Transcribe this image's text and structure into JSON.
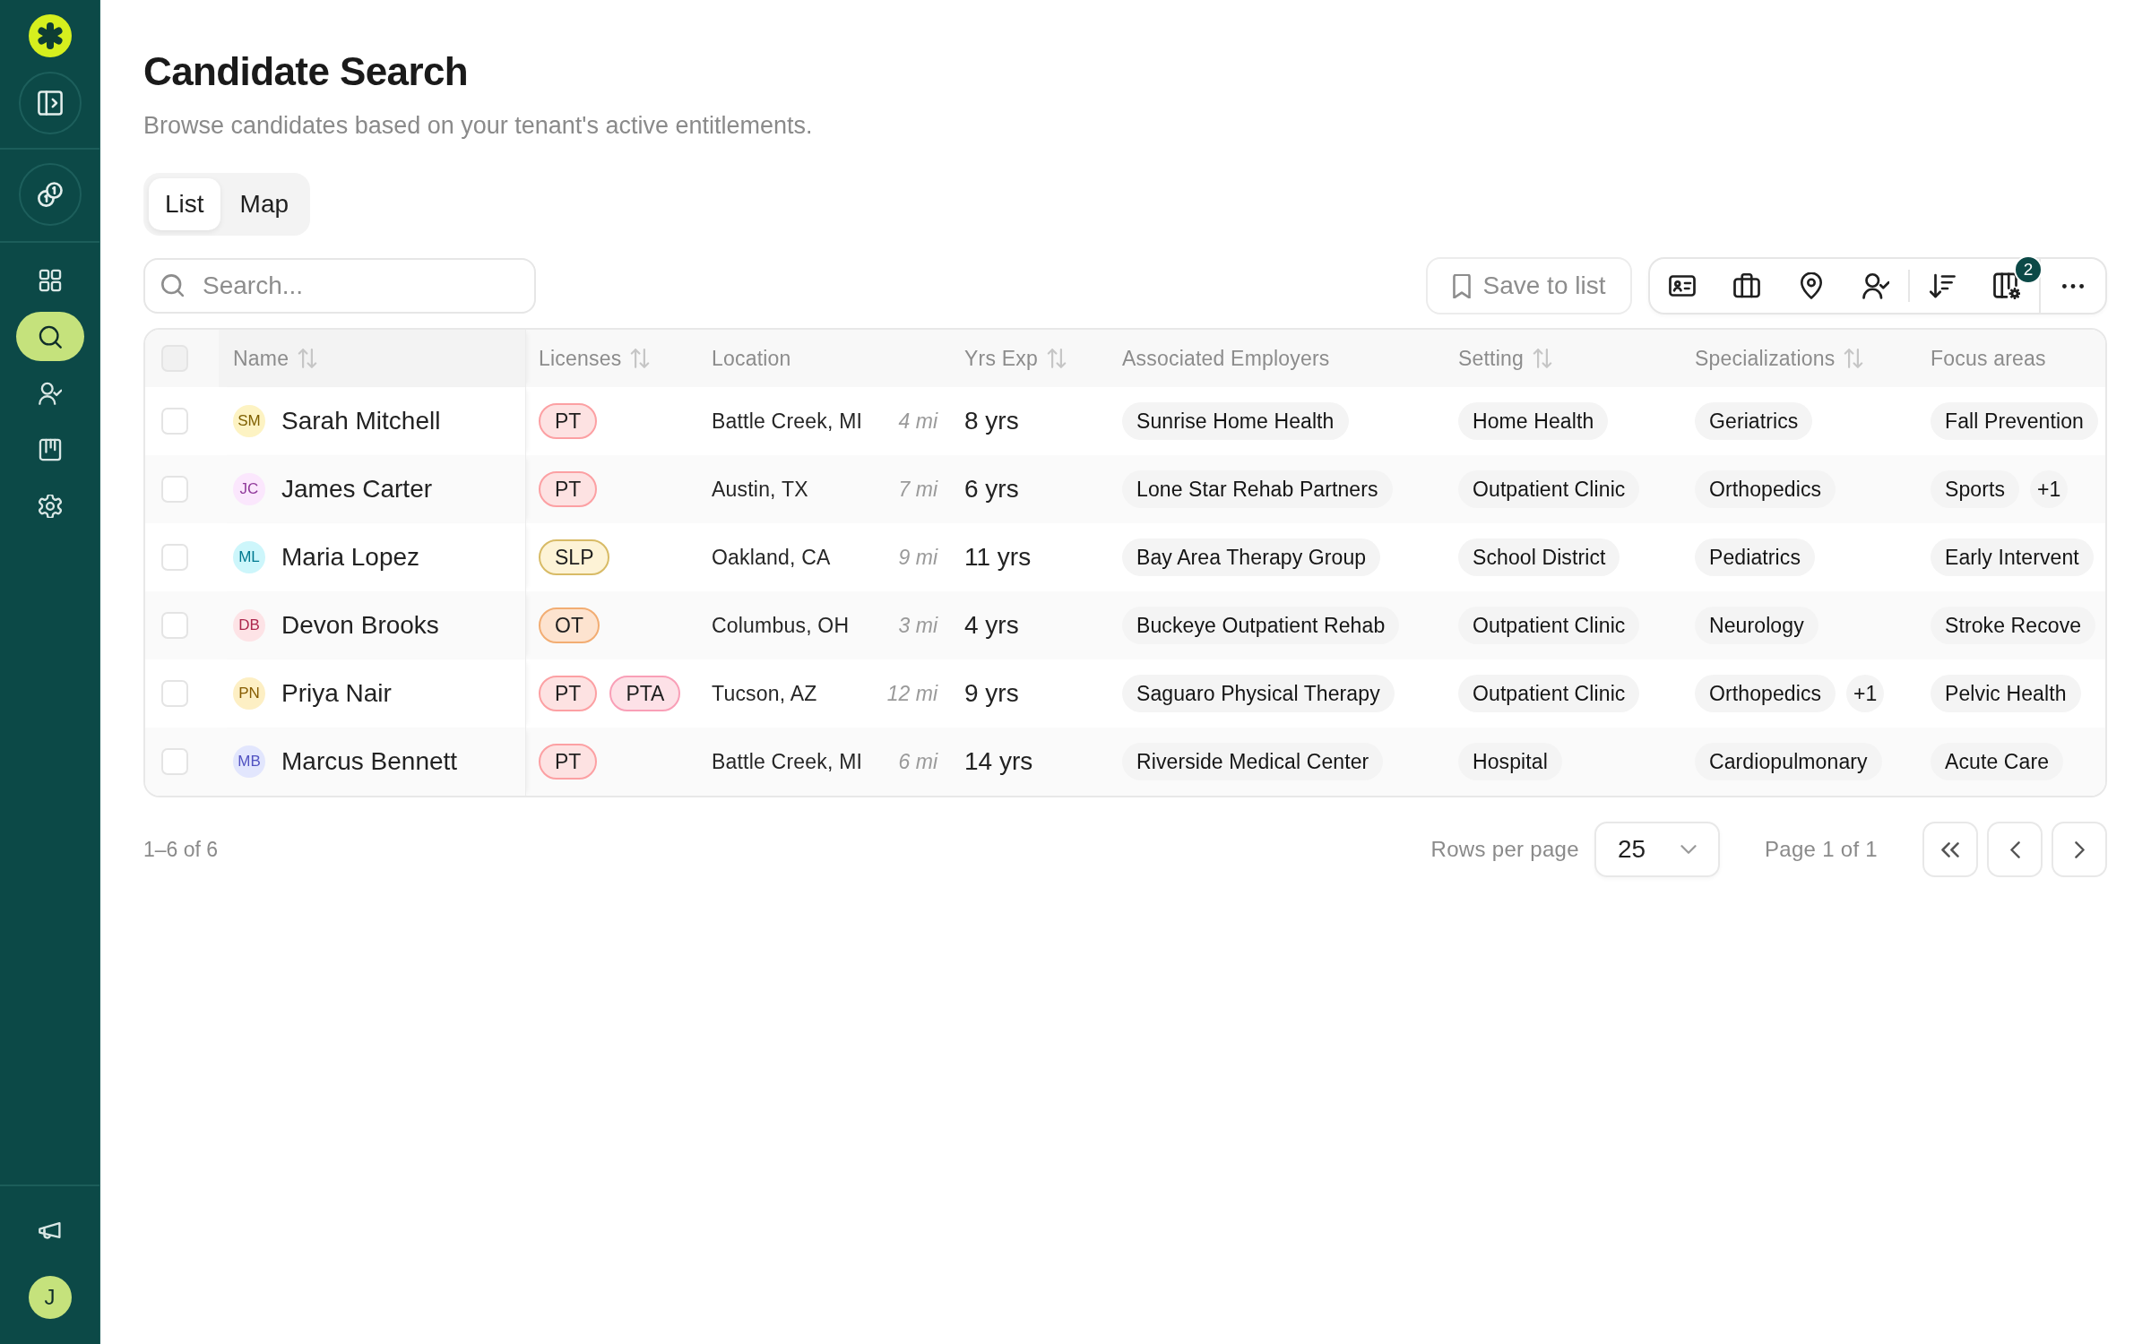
{
  "sidebar": {
    "nav": [
      {
        "selected": false
      },
      {
        "selected": true
      },
      {
        "selected": false
      },
      {
        "selected": false
      },
      {
        "selected": false
      }
    ],
    "user_avatar": "J"
  },
  "header": {
    "title": "Candidate Search",
    "subtitle": "Browse candidates based on your tenant's active entitlements."
  },
  "view_tabs": [
    {
      "label": "List",
      "selected": true
    },
    {
      "label": "Map",
      "selected": false
    }
  ],
  "search": {
    "placeholder": "Search..."
  },
  "toolbar": {
    "save_button": "Save to list",
    "columns_badge": "2"
  },
  "table": {
    "select_all": {
      "checked": false
    },
    "columns": [
      {
        "label": "Name",
        "sortable": true
      },
      {
        "label": "Licenses",
        "sortable": true
      },
      {
        "label": "Location",
        "sortable": false
      },
      {
        "label": "Yrs Exp",
        "sortable": true
      },
      {
        "label": "Associated Employers",
        "sortable": false
      },
      {
        "label": "Setting",
        "sortable": true
      },
      {
        "label": "Specializations",
        "sortable": true
      },
      {
        "label": "Focus areas",
        "sortable": false
      }
    ],
    "rows": [
      {
        "checked": false,
        "initials": "SM",
        "color": "#fdf3c3",
        "name": "Sarah Mitchell",
        "licenses": [
          {
            "label": "PT",
            "color": "#fde2e2"
          }
        ],
        "location": "Battle Creek, MI",
        "distance": "4 mi",
        "experience": "8 yrs",
        "employer": "Sunrise Home Health",
        "setting": "Home Health",
        "specialization": "Geriatrics",
        "focus_area": "Fall Prevention"
      },
      {
        "checked": false,
        "initials": "JC",
        "color": "#fbe7fd",
        "name": "James Carter",
        "licenses": [
          {
            "label": "PT",
            "color": "#fde2e2"
          }
        ],
        "location": "Austin, TX",
        "distance": "7 mi",
        "experience": "6 yrs",
        "employer": "Lone Star Rehab Partners",
        "setting": "Outpatient Clinic",
        "specialization": "Orthopedics",
        "focus_area": "Sports",
        "focus_more": "+1"
      },
      {
        "checked": false,
        "initials": "ML",
        "color": "#cdf6fb",
        "name": "Maria Lopez",
        "licenses": [
          {
            "label": "SLP",
            "color": "#fdf3d6"
          }
        ],
        "location": "Oakland, CA",
        "distance": "9 mi",
        "experience": "11 yrs",
        "employer": "Bay Area Therapy Group",
        "setting": "School District",
        "specialization": "Pediatrics",
        "focus_area": "Early Intervent"
      },
      {
        "checked": false,
        "initials": "DB",
        "color": "#fde3e6",
        "name": "Devon Brooks",
        "licenses": [
          {
            "label": "OT",
            "color": "#fde3cf"
          }
        ],
        "location": "Columbus, OH",
        "distance": "3 mi",
        "experience": "4 yrs",
        "employer": "Buckeye Outpatient Rehab",
        "setting": "Outpatient Clinic",
        "specialization": "Neurology",
        "focus_area": "Stroke Recove"
      },
      {
        "checked": false,
        "initials": "PN",
        "color": "#fdefc4",
        "name": "Priya Nair",
        "licenses": [
          {
            "label": "PT",
            "color": "#fde2e2"
          },
          {
            "label": "PTA",
            "color": "#fde1e7"
          }
        ],
        "location": "Tucson, AZ",
        "distance": "12 mi",
        "experience": "9 yrs",
        "employer": "Saguaro Physical Therapy",
        "setting": "Outpatient Clinic",
        "specialization": "Orthopedics",
        "specialization_more": "+1",
        "focus_area": "Pelvic Health"
      },
      {
        "checked": false,
        "initials": "MB",
        "color": "#e2e6fd",
        "name": "Marcus Bennett",
        "licenses": [
          {
            "label": "PT",
            "color": "#fde2e2"
          }
        ],
        "location": "Battle Creek, MI",
        "distance": "6 mi",
        "experience": "14 yrs",
        "employer": "Riverside Medical Center",
        "setting": "Hospital",
        "specialization": "Cardiopulmonary",
        "focus_area": "Acute Care"
      }
    ]
  },
  "pagination": {
    "range": "1–6 of 6",
    "rows_per_page_label": "Rows per page",
    "rows_per_page": "25",
    "page": "Page 1 of 1"
  }
}
